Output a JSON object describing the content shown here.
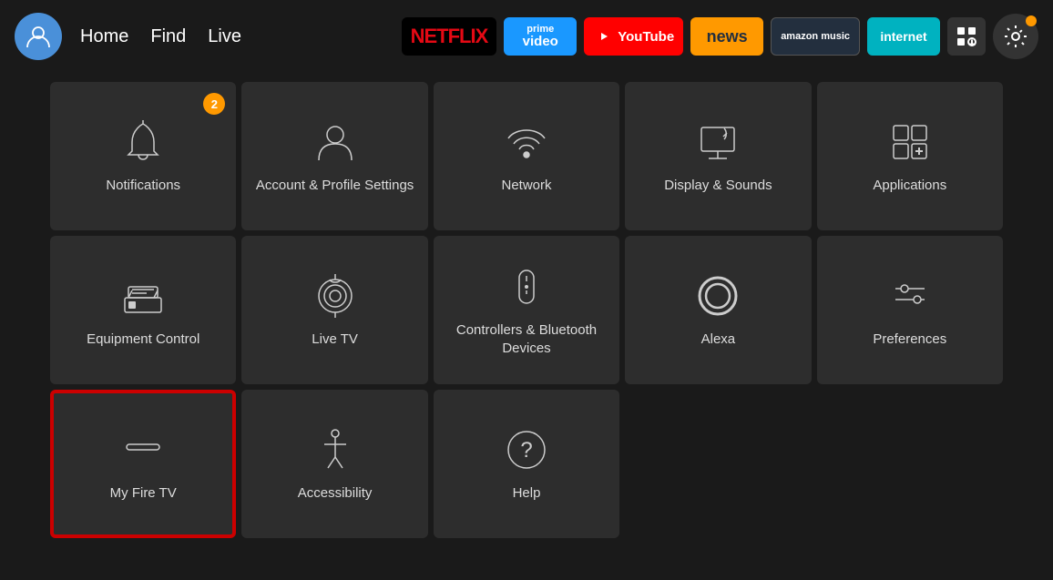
{
  "navbar": {
    "nav_links": [
      "Home",
      "Find",
      "Live"
    ],
    "apps": [
      {
        "id": "netflix",
        "label": "NETFLIX",
        "class": "app-netflix"
      },
      {
        "id": "primevideo",
        "label": "prime video",
        "class": "app-primevideo"
      },
      {
        "id": "youtube",
        "label": "▶ YouTube",
        "class": "app-youtube"
      },
      {
        "id": "news",
        "label": "news",
        "class": "app-news"
      },
      {
        "id": "amazonmusic",
        "label": "amazon music",
        "class": "app-amazonmusic"
      },
      {
        "id": "internet",
        "label": "internet",
        "class": "app-internet"
      }
    ]
  },
  "tiles": [
    {
      "id": "notifications",
      "label": "Notifications",
      "badge": "2",
      "selected": false
    },
    {
      "id": "account-profile",
      "label": "Account & Profile Settings",
      "badge": null,
      "selected": false
    },
    {
      "id": "network",
      "label": "Network",
      "badge": null,
      "selected": false
    },
    {
      "id": "display-sounds",
      "label": "Display & Sounds",
      "badge": null,
      "selected": false
    },
    {
      "id": "applications",
      "label": "Applications",
      "badge": null,
      "selected": false
    },
    {
      "id": "equipment-control",
      "label": "Equipment Control",
      "badge": null,
      "selected": false
    },
    {
      "id": "live-tv",
      "label": "Live TV",
      "badge": null,
      "selected": false
    },
    {
      "id": "controllers-bluetooth",
      "label": "Controllers & Bluetooth Devices",
      "badge": null,
      "selected": false
    },
    {
      "id": "alexa",
      "label": "Alexa",
      "badge": null,
      "selected": false
    },
    {
      "id": "preferences",
      "label": "Preferences",
      "badge": null,
      "selected": false
    },
    {
      "id": "my-fire-tv",
      "label": "My Fire TV",
      "badge": null,
      "selected": true
    },
    {
      "id": "accessibility",
      "label": "Accessibility",
      "badge": null,
      "selected": false
    },
    {
      "id": "help",
      "label": "Help",
      "badge": null,
      "selected": false
    }
  ]
}
